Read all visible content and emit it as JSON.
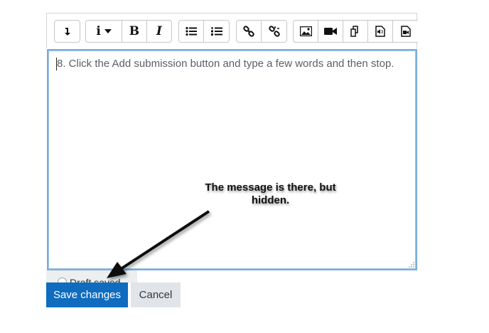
{
  "toolbar": {
    "buttons": [
      {
        "icon": "collapse-toggle-icon"
      },
      {
        "icon": "paragraph-styles-icon",
        "label": "i"
      },
      {
        "icon": "bold-icon",
        "label": "B"
      },
      {
        "icon": "italic-icon",
        "label": "I"
      },
      {
        "icon": "unordered-list-icon"
      },
      {
        "icon": "ordered-list-icon"
      },
      {
        "icon": "link-icon"
      },
      {
        "icon": "unlink-icon"
      },
      {
        "icon": "image-icon"
      },
      {
        "icon": "video-icon"
      },
      {
        "icon": "manage-files-icon"
      },
      {
        "icon": "record-audio-icon"
      },
      {
        "icon": "record-video-icon"
      }
    ]
  },
  "editor": {
    "text": "8. Click the Add submission button and type a few words and then stop."
  },
  "annotation": {
    "line1": "The message is there, but",
    "line2": "hidden."
  },
  "draft": {
    "label": "Draft saved"
  },
  "actions": {
    "save_label": "Save changes",
    "cancel_label": "Cancel"
  },
  "colors": {
    "primary": "#0f6cbf",
    "focus_border": "#7aacde"
  }
}
